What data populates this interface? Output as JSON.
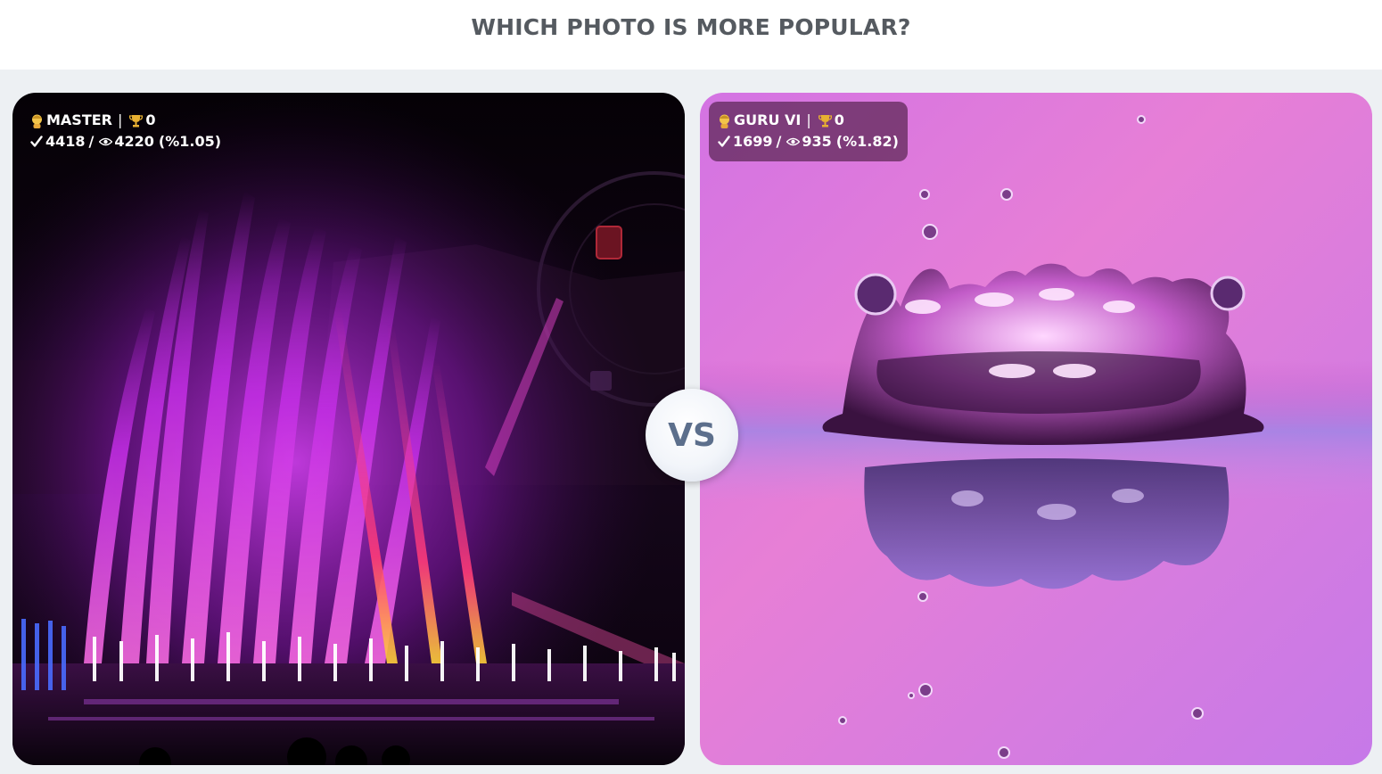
{
  "page": {
    "title": "WHICH PHOTO IS MORE POPULAR?"
  },
  "versus_label": "VS",
  "photos": [
    {
      "rank": "MASTER",
      "trophies": "0",
      "likes": "4418",
      "views": "4220",
      "ratio": "(%1.05)",
      "subject": "illuminated purple fountain show at night"
    },
    {
      "rank": "GURU VI",
      "trophies": "0",
      "likes": "1699",
      "views": "935",
      "ratio": "(%1.82)",
      "subject": "water droplet crown splash on pink background"
    }
  ],
  "icons": {
    "rank": "user-badge-icon",
    "trophy": "trophy-icon",
    "likes": "check-icon",
    "views": "eye-icon"
  },
  "colors": {
    "header_text": "#555a60",
    "arena_bg": "#edf0f3",
    "vs_text": "#5c6f8c"
  }
}
